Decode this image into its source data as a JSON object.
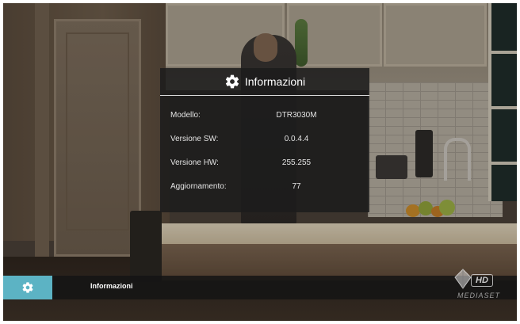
{
  "panel": {
    "title": "Informazioni",
    "icon": "gear-icon",
    "rows": [
      {
        "label": "Modello:",
        "value": "DTR3030M"
      },
      {
        "label": "Versione SW:",
        "value": "0.0.4.4"
      },
      {
        "label": "Versione HW:",
        "value": "255.255"
      },
      {
        "label": "Aggiornamento:",
        "value": "77"
      }
    ]
  },
  "bottom_bar": {
    "icon": "gear-icon",
    "label": "Informazioni",
    "accent_color": "#5cb3c4"
  },
  "watermark": {
    "badge": "HD",
    "brand": "MEDIASET"
  }
}
